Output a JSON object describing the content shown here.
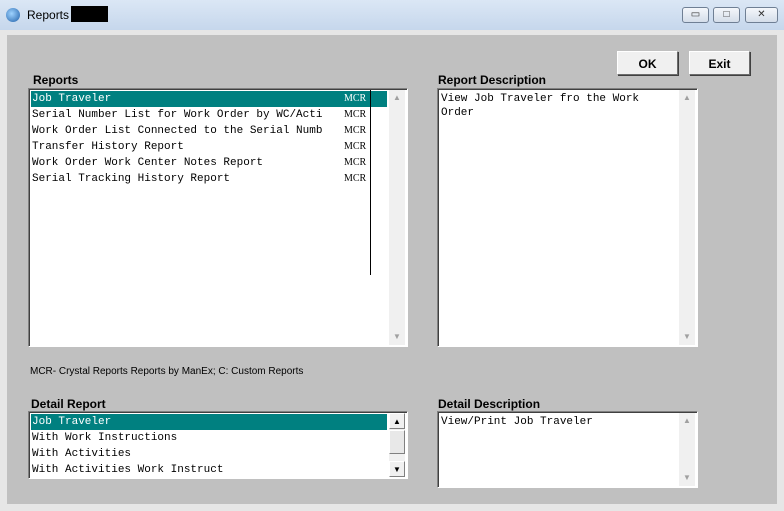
{
  "window": {
    "title": "Reports",
    "buttons": {
      "minimize": "▭",
      "maximize": "□",
      "close": "✕"
    }
  },
  "actions": {
    "ok": "OK",
    "exit": "Exit"
  },
  "reports": {
    "label": "Reports",
    "items": [
      {
        "name": "Job Traveler",
        "code": "MCR",
        "selected": true
      },
      {
        "name": "Serial Number List for Work Order by WC/Acti",
        "code": "MCR"
      },
      {
        "name": "Work Order List Connected to the Serial Numb",
        "code": "MCR"
      },
      {
        "name": "Transfer History Report",
        "code": "MCR"
      },
      {
        "name": "Work Order Work Center Notes Report",
        "code": "MCR"
      },
      {
        "name": "Serial Tracking History Report",
        "code": "MCR"
      }
    ]
  },
  "report_description": {
    "label": "Report Description",
    "text": "View Job Traveler fro the Work\nOrder"
  },
  "legend_note": "MCR- Crystal Reports Reports by ManEx;  C: Custom Reports",
  "detail_report": {
    "label": "Detail Report",
    "items": [
      {
        "name": "Job Traveler",
        "selected": true
      },
      {
        "name": "With Work Instructions"
      },
      {
        "name": "With Activities"
      },
      {
        "name": "With Activities Work Instruct"
      }
    ]
  },
  "detail_description": {
    "label": "Detail Description",
    "text": "View/Print Job Traveler"
  },
  "colors": {
    "selection": "#008080",
    "dialog_bg": "#c0c0c0"
  }
}
